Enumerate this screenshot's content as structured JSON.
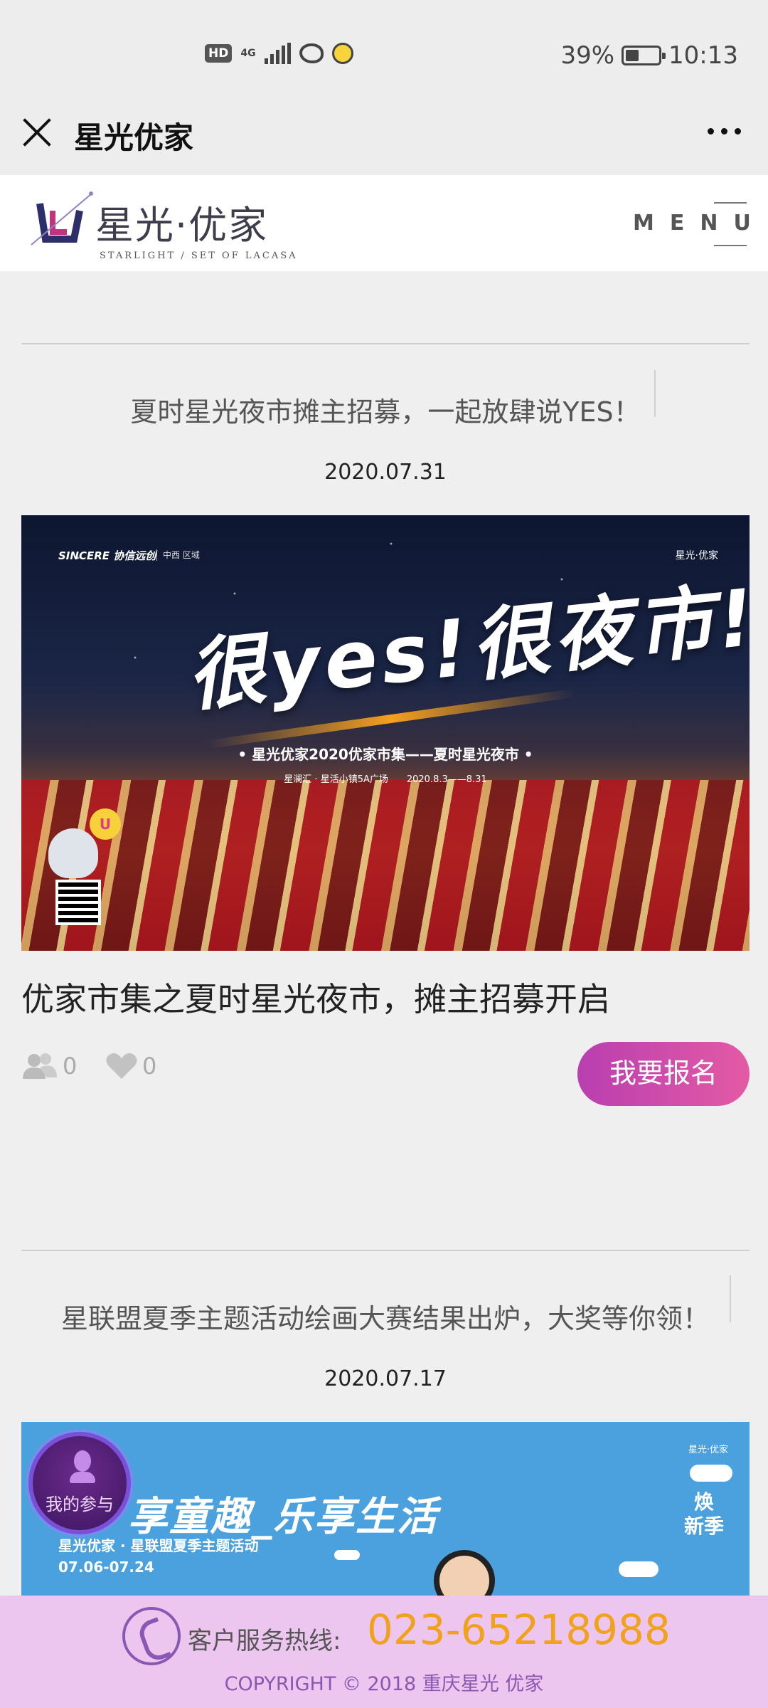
{
  "status_bar": {
    "hd_badge": "HD",
    "network": "4G",
    "battery_percent": "39%",
    "time": "10:13",
    "icons": [
      "hd-icon",
      "signal-icon",
      "weibo-icon",
      "emoji-icon",
      "battery-icon"
    ]
  },
  "titlebar": {
    "title": "星光优家"
  },
  "site_header": {
    "logo_cn": "星光·优家",
    "logo_en": "STARLIGHT / SET OF LACASA",
    "menu_label": "MENU"
  },
  "articles": [
    {
      "title": "夏时星光夜市摊主招募，一起放肆说YES！",
      "date": "2020.07.31",
      "banner": {
        "brand": "SINCERE 协信远创",
        "region": "中西\n区域",
        "logo": "星光·优家",
        "headline": "很yes!很夜市!",
        "subtitle": "• 星光优家2020优家市集——夏时星光夜市 •",
        "info": "星澜汇 · 星活小镇5A广场　　2020.8.3——8.31",
        "badge": "U"
      },
      "name": "优家市集之夏时星光夜市，摊主招募开启",
      "participants": "0",
      "likes": "0",
      "signup_label": "我要报名"
    },
    {
      "title": "星联盟夏季主题活动绘画大赛结果出炉，大奖等你领！",
      "date": "2020.07.17",
      "banner": {
        "title": "享童趣_乐享生活",
        "subtitle": "星光优家 · 星联盟夏季主题活动",
        "dates": "07.06-07.24",
        "logo": "星光·优家",
        "new_season": "焕\n新季"
      }
    }
  ],
  "float_button": {
    "label": "我的参与"
  },
  "footer": {
    "hotline_label": "客户服务热线:",
    "hotline_number": "023-65218988",
    "copyright": "COPYRIGHT © 2018 重庆星光 优家"
  },
  "colors": {
    "accent_pink": "#e45aa4",
    "accent_purple": "#b93fb0",
    "hotline_orange": "#f0a21c",
    "footer_bg": "#ecc6ef"
  }
}
